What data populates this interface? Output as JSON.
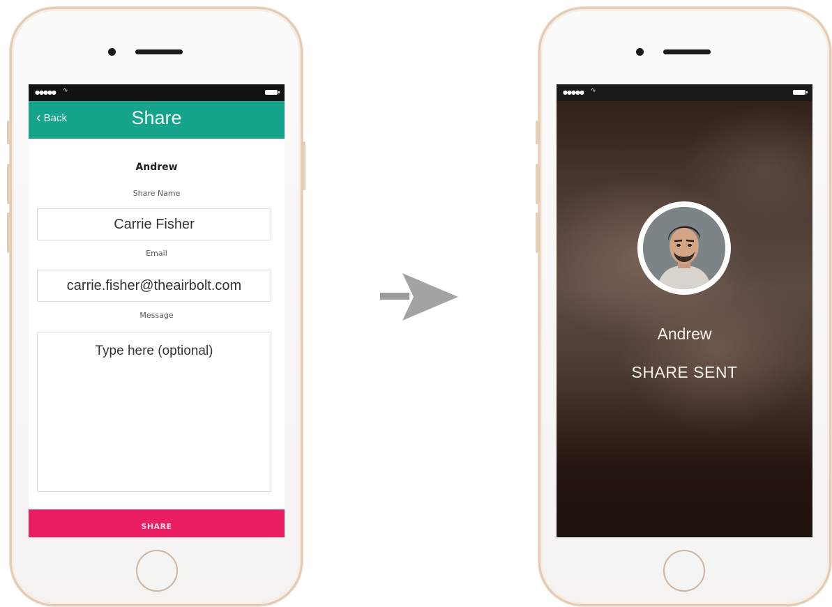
{
  "left_screen": {
    "nav": {
      "back_label": "Back",
      "title": "Share"
    },
    "contact_name": "Andrew",
    "fields": {
      "share_name_label": "Share Name",
      "share_name_value": "Carrie Fisher",
      "email_label": "Email",
      "email_value": "carrie.fisher@theairbolt.com",
      "message_label": "Message",
      "message_placeholder": "Type here (optional)"
    },
    "share_button_label": "SHARE",
    "colors": {
      "nav_bar": "#17a48c",
      "share_button": "#ea1f63"
    }
  },
  "right_screen": {
    "name": "Andrew",
    "status": "SHARE SENT"
  },
  "icons": {
    "status_bar": [
      "signal-dots-icon",
      "wifi-icon",
      "battery-icon"
    ],
    "nav": "chevron-left-icon",
    "transition": "arrow-right-icon"
  }
}
